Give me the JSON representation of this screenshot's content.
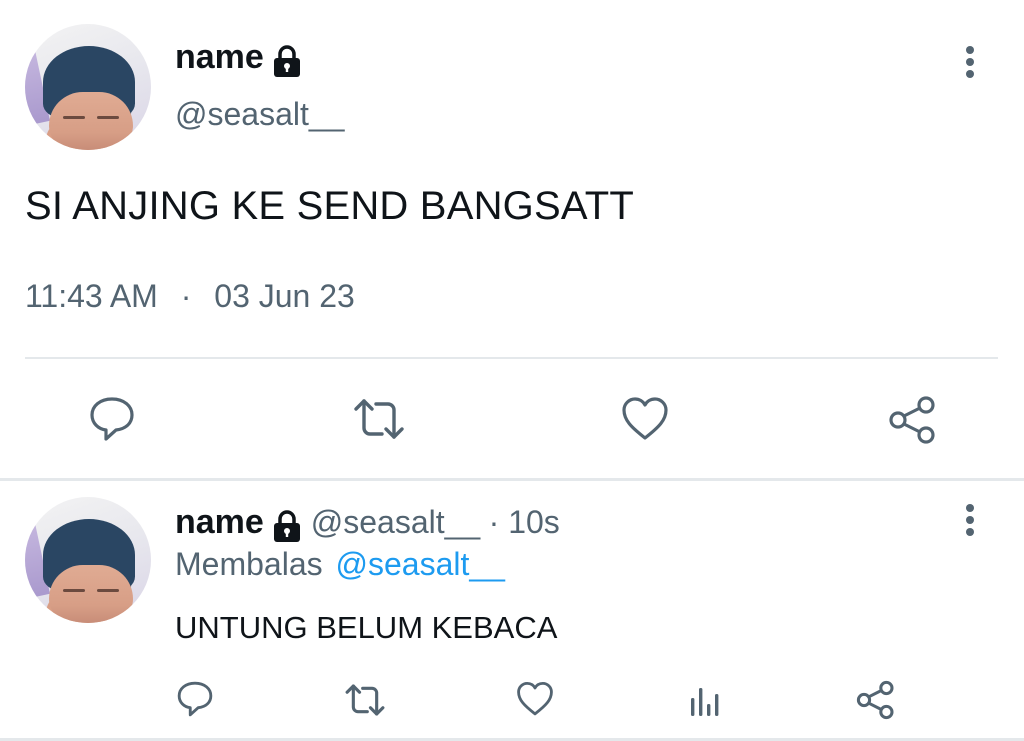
{
  "main_tweet": {
    "display_name": "name",
    "handle": "@seasalt__",
    "text": "SI ANJING KE SEND BANGSATT",
    "time": "11:43 AM",
    "separator": "·",
    "date": "03 Jun 23",
    "icons": {
      "lock": "lock-icon",
      "more": "more-vertical-icon",
      "reply": "reply-icon",
      "retweet": "retweet-icon",
      "like": "like-icon",
      "share": "share-icon"
    }
  },
  "reply_tweet": {
    "display_name": "name",
    "handle": "@seasalt__",
    "time_ago": "· 10s",
    "replying_prefix": "Membalas",
    "replying_to": "@seasalt__",
    "text": "UNTUNG BELUM KEBACA",
    "icons": {
      "lock": "lock-icon",
      "more": "more-vertical-icon",
      "reply": "reply-icon",
      "retweet": "retweet-icon",
      "like": "like-icon",
      "analytics": "analytics-icon",
      "share": "share-icon"
    }
  },
  "colors": {
    "text": "#0f1419",
    "muted": "#536471",
    "link": "#1d9bf0",
    "divider": "#e4e8eb"
  }
}
